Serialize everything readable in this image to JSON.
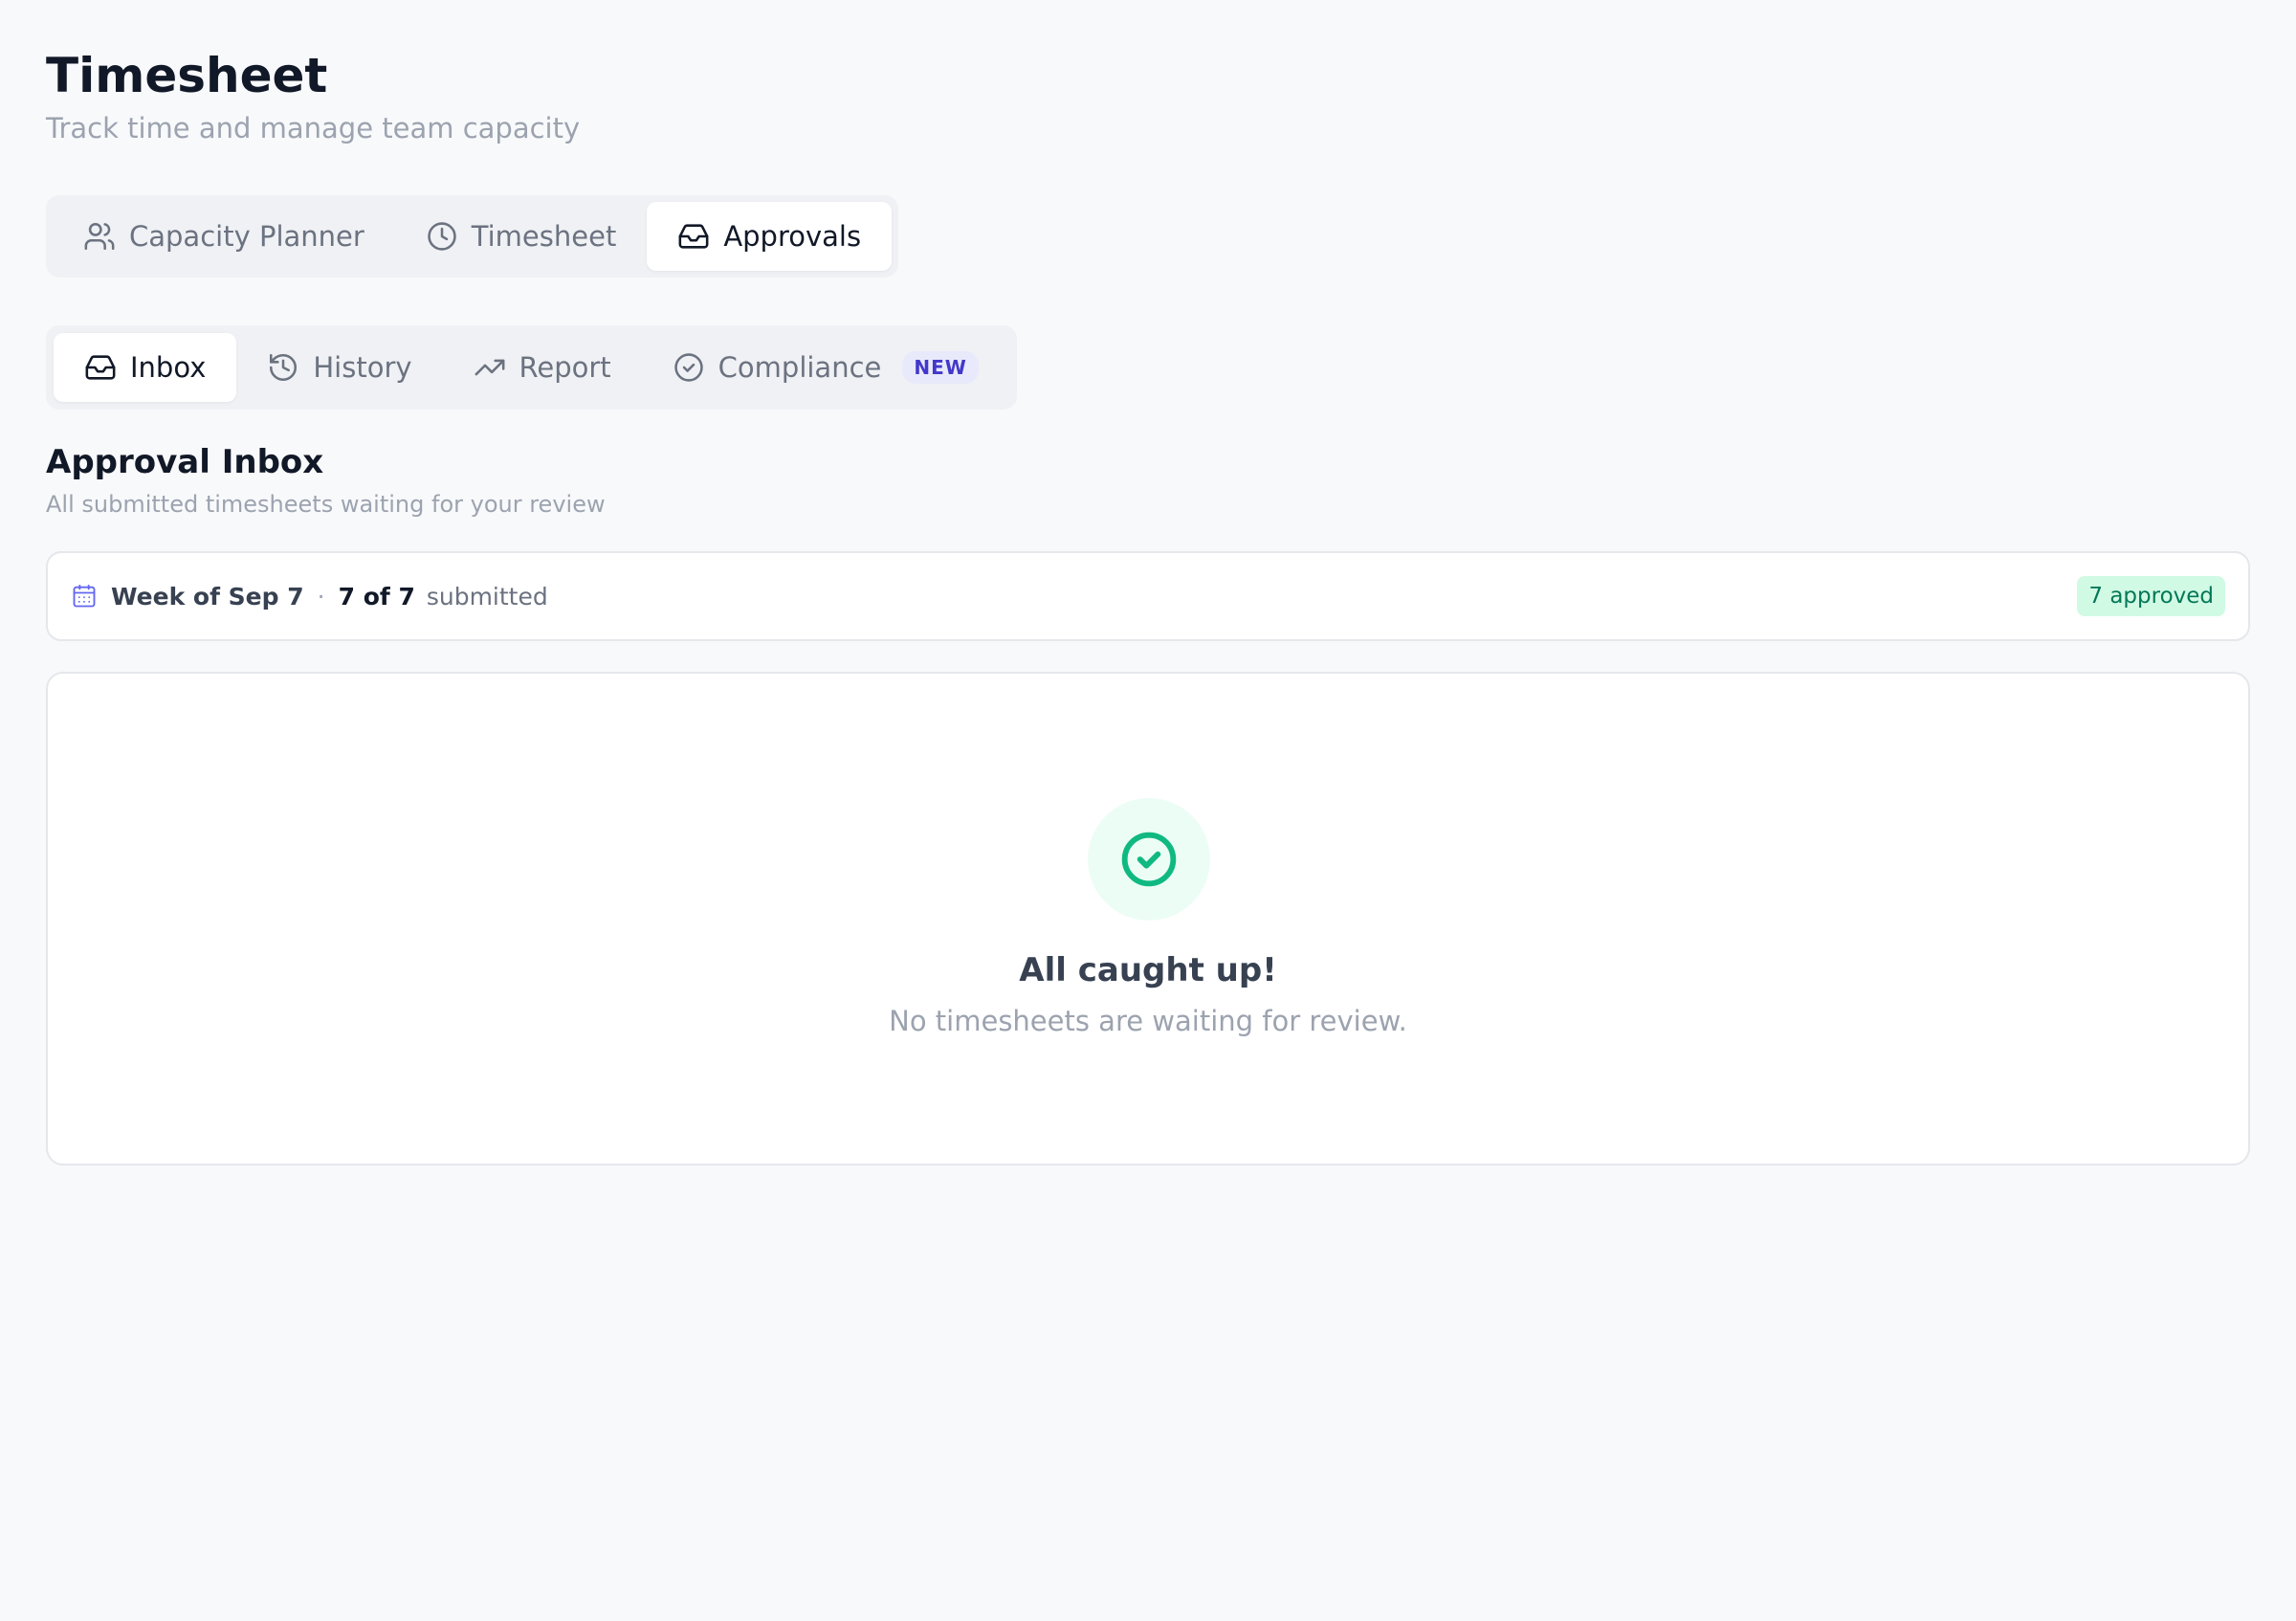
{
  "header": {
    "title": "Timesheet",
    "subtitle": "Track time and manage team capacity"
  },
  "main_tabs": [
    {
      "label": "Capacity Planner",
      "icon": "users-icon",
      "active": false
    },
    {
      "label": "Timesheet",
      "icon": "clock-icon",
      "active": false
    },
    {
      "label": "Approvals",
      "icon": "inbox-icon",
      "active": true
    }
  ],
  "sub_tabs": [
    {
      "label": "Inbox",
      "icon": "inbox-icon",
      "active": true
    },
    {
      "label": "History",
      "icon": "history-icon",
      "active": false
    },
    {
      "label": "Report",
      "icon": "trending-up-icon",
      "active": false
    },
    {
      "label": "Compliance",
      "icon": "check-circle-icon",
      "active": false,
      "badge": "NEW"
    }
  ],
  "section": {
    "title": "Approval Inbox",
    "subtitle": "All submitted timesheets waiting for your review"
  },
  "week_bar": {
    "icon": "calendar-icon",
    "week_label": "Week of Sep 7",
    "separator": "·",
    "count": "7 of 7",
    "status": "submitted",
    "approved_badge": "7 approved"
  },
  "empty_state": {
    "icon": "check-circle-icon",
    "title": "All caught up!",
    "message": "No timesheets are waiting for review."
  },
  "colors": {
    "accent": "#4338ca",
    "success": "#10b981",
    "success_bg": "#ecfdf5",
    "approved_bg": "#d1fae5",
    "approved_text": "#047857"
  }
}
